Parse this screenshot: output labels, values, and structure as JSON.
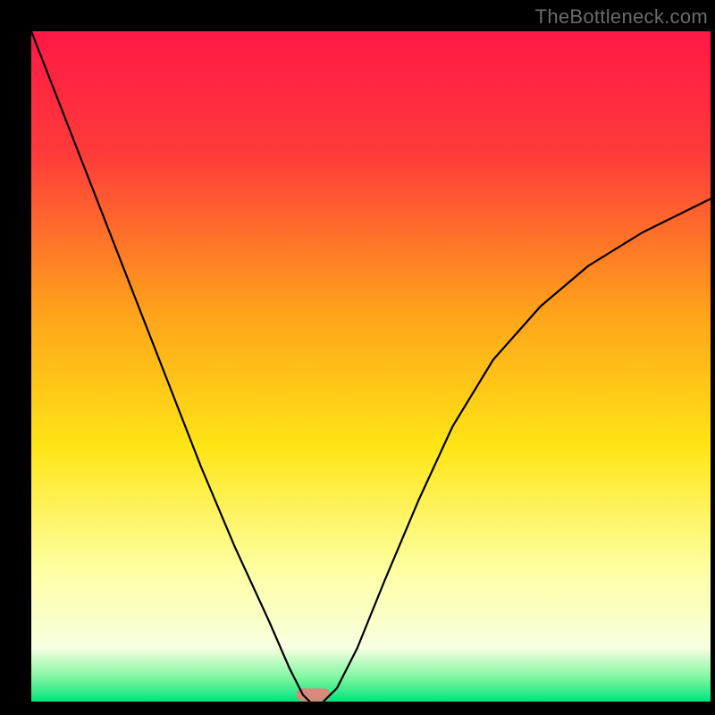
{
  "watermark": "TheBottleneck.com",
  "chart_data": {
    "type": "line",
    "title": "",
    "xlabel": "",
    "ylabel": "",
    "xlim": [
      0,
      100
    ],
    "ylim": [
      0,
      100
    ],
    "series": [
      {
        "name": "bottleneck-curve-left",
        "x": [
          0,
          5,
          10,
          15,
          20,
          25,
          30,
          35,
          38,
          40,
          41
        ],
        "values": [
          100,
          87,
          74,
          61,
          48,
          35,
          23,
          12,
          5,
          1,
          0
        ]
      },
      {
        "name": "bottleneck-curve-right",
        "x": [
          43,
          45,
          48,
          52,
          57,
          62,
          68,
          75,
          82,
          90,
          100
        ],
        "values": [
          0,
          2,
          8,
          18,
          30,
          41,
          51,
          59,
          65,
          70,
          75
        ]
      }
    ],
    "marker": {
      "name": "optimal-zone",
      "x_center": 41.5,
      "width": 5,
      "color": "#d88a7a"
    },
    "gradient_bands": [
      {
        "stop": 0.0,
        "color": "#ff1846"
      },
      {
        "stop": 0.18,
        "color": "#ff3a3a"
      },
      {
        "stop": 0.42,
        "color": "#ffa31a"
      },
      {
        "stop": 0.62,
        "color": "#ffe516"
      },
      {
        "stop": 0.8,
        "color": "#feffa0"
      },
      {
        "stop": 0.92,
        "color": "#f8ffe0"
      },
      {
        "stop": 0.965,
        "color": "#7cf6a0"
      },
      {
        "stop": 1.0,
        "color": "#00e37a"
      }
    ]
  }
}
